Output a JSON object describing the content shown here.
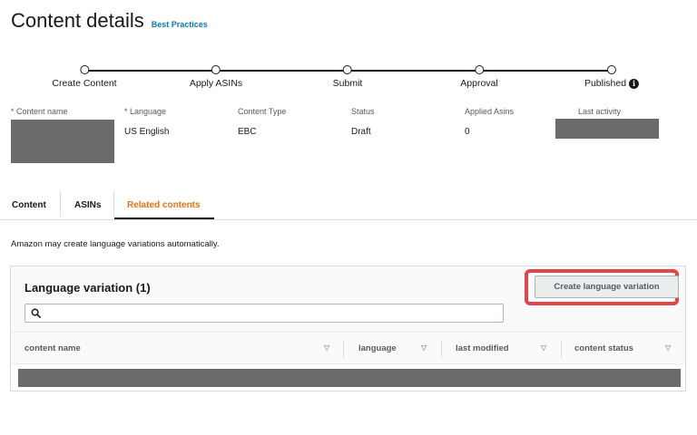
{
  "header": {
    "title": "Content details",
    "best_practices_link": "Best Practices"
  },
  "stepper": {
    "steps": [
      {
        "label": "Create Content"
      },
      {
        "label": "Apply ASINs"
      },
      {
        "label": "Submit"
      },
      {
        "label": "Approval"
      },
      {
        "label": "Published"
      }
    ],
    "info_icon_glyph": "i"
  },
  "details": {
    "content_name": {
      "label": "* Content name",
      "value": ""
    },
    "language": {
      "label": "* Language",
      "value": "US English"
    },
    "content_type": {
      "label": "Content Type",
      "value": "EBC"
    },
    "status": {
      "label": "Status",
      "value": "Draft"
    },
    "applied_asins": {
      "label": "Applied Asins",
      "value": "0"
    },
    "last_activity": {
      "label": "Last activity",
      "value": ""
    }
  },
  "tabs": [
    {
      "label": "Content"
    },
    {
      "label": "ASINs"
    },
    {
      "label": "Related contents",
      "active": true
    }
  ],
  "note": "Amazon may create language variations automatically.",
  "language_variation": {
    "title": "Language variation (1)",
    "search_placeholder": "",
    "create_button": "Create language variation",
    "columns": [
      {
        "label": "content name"
      },
      {
        "label": "language"
      },
      {
        "label": "last modified"
      },
      {
        "label": "content status"
      }
    ],
    "sort_glyph": "▽"
  },
  "colors": {
    "accent": "#ec7211",
    "link": "#0a7bb4",
    "highlight": "#e0454b",
    "redaction": "#6b6b6b"
  }
}
